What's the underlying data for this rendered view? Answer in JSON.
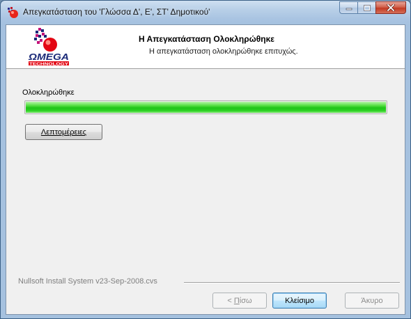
{
  "window": {
    "title": "Απεγκατάσταση του 'Γλώσσα Δ', Ε', ΣΤ' Δημοτικού'"
  },
  "header": {
    "title": "Η Απεγκατάσταση Ολοκληρώθηκε",
    "subtitle": "Η απεγκατάσταση ολοκληρώθηκε επιτυχώς.",
    "logo_text": "ΩMEGA",
    "logo_subtext": "TECHNOLOGY"
  },
  "main": {
    "status_label": "Ολοκληρώθηκε",
    "progress_percent": 100,
    "details_button": "Λεπτομέρειες"
  },
  "footer": {
    "branding": "Nullsoft Install System v23-Sep-2008.cvs",
    "back_button_prefix": "< ",
    "back_button_accel": "Π",
    "back_button_rest": "ίσω",
    "close_button": "Κλείσιμο",
    "cancel_button": "Άκυρο"
  },
  "colors": {
    "progress_green": "#1fc418",
    "logo_red": "#e30613",
    "logo_navy": "#1b2a78"
  }
}
